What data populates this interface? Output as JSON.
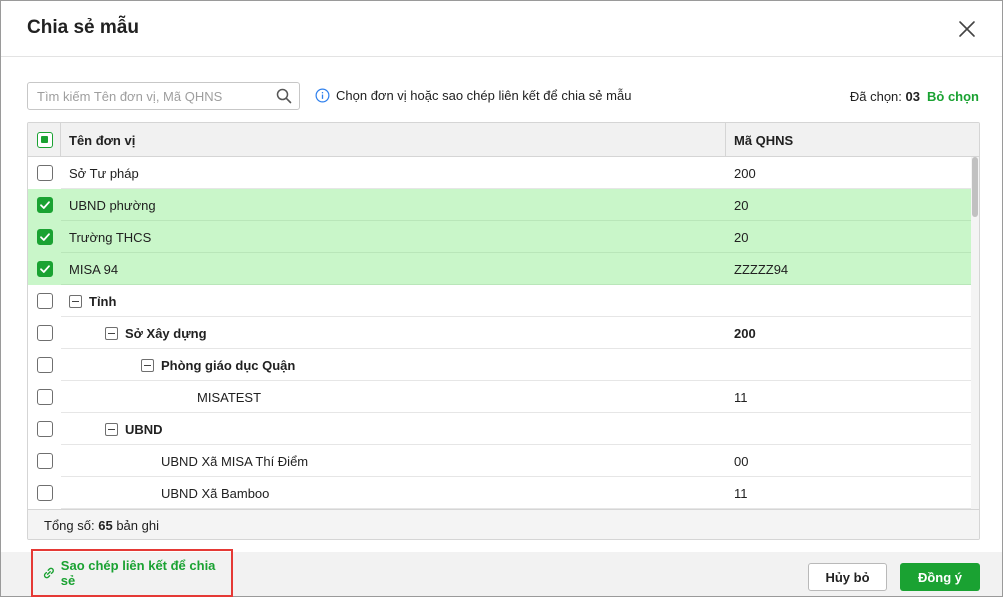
{
  "dialog": {
    "title": "Chia sẻ mẫu",
    "close_icon": "close-icon"
  },
  "search": {
    "placeholder": "Tìm kiếm Tên đơn vị, Mã QHNS",
    "value": "",
    "icon": "search-icon"
  },
  "hint": {
    "icon": "info-icon",
    "text": "Chọn đơn vị hoặc sao chép liên kết để chia sẻ mẫu"
  },
  "selection": {
    "label": "Đã chọn:",
    "count": "03",
    "deselect_label": "Bỏ chọn"
  },
  "grid": {
    "columns": {
      "name": "Tên đơn vị",
      "code": "Mã QHNS"
    },
    "rows": [
      {
        "name": "Sở Tư pháp",
        "code": "200",
        "checked": false,
        "level": 0,
        "group": false
      },
      {
        "name": "UBND phường",
        "code": "20",
        "checked": true,
        "level": 0,
        "group": false
      },
      {
        "name": "Trường THCS",
        "code": "20",
        "checked": true,
        "level": 0,
        "group": false
      },
      {
        "name": "MISA 94",
        "code": "ZZZZZ94",
        "checked": true,
        "level": 0,
        "group": false
      },
      {
        "name": "Tỉnh",
        "code": "",
        "checked": false,
        "level": 0,
        "group": true
      },
      {
        "name": "Sở Xây dựng",
        "code": "200",
        "checked": false,
        "level": 1,
        "group": true
      },
      {
        "name": "Phòng giáo dục Quận",
        "code": "",
        "checked": false,
        "level": 2,
        "group": true
      },
      {
        "name": "MISATEST",
        "code": "11",
        "checked": false,
        "level": 3,
        "group": false
      },
      {
        "name": "UBND",
        "code": "",
        "checked": false,
        "level": 1,
        "group": true
      },
      {
        "name": "UBND Xã MISA Thí Điểm",
        "code": "00",
        "checked": false,
        "level": 2,
        "group": false
      },
      {
        "name": "UBND Xã Bamboo",
        "code": "11",
        "checked": false,
        "level": 2,
        "group": false
      }
    ],
    "footer": {
      "total_label": "Tổng số:",
      "total_count": "65",
      "total_unit": "bản ghi"
    }
  },
  "actions": {
    "copy_link_label": "Sao chép liên kết để chia sẻ",
    "copy_link_icon": "link-icon",
    "cancel_label": "Hủy bỏ",
    "ok_label": "Đồng ý"
  },
  "colors": {
    "accent": "#1aa232",
    "selected_row": "#c9f6c9",
    "highlight_border": "#e53935"
  }
}
